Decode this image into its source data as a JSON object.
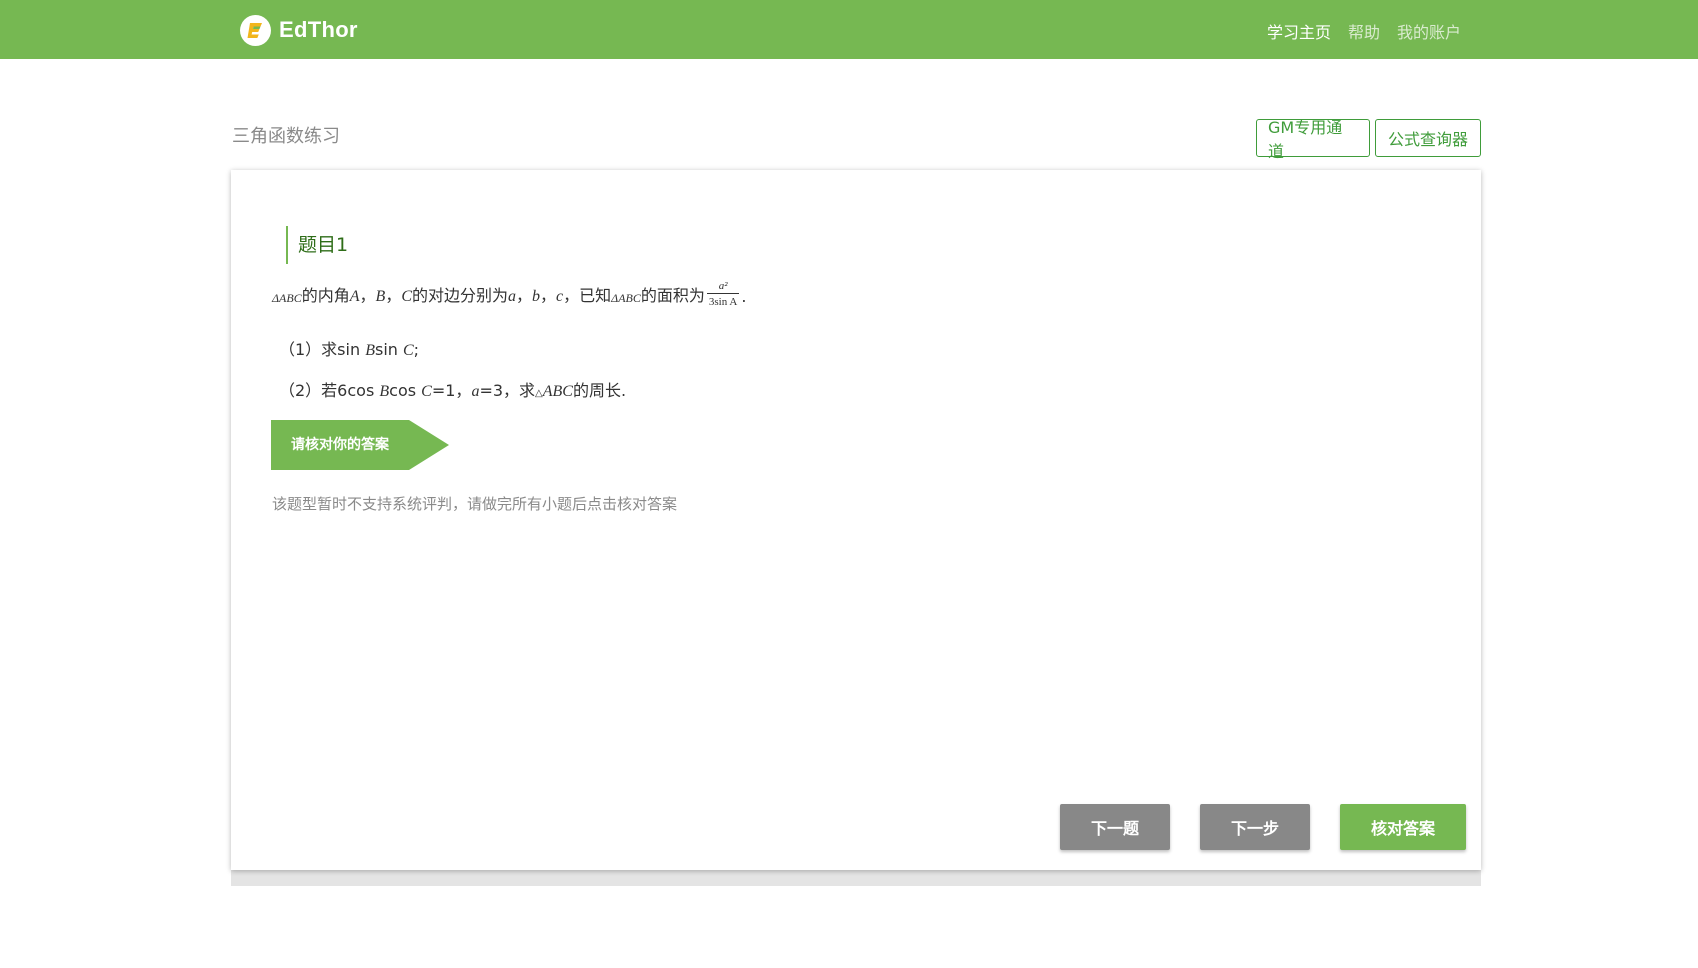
{
  "header": {
    "brand": "EdThor",
    "nav": [
      {
        "label": "学习主页",
        "active": true
      },
      {
        "label": "帮助",
        "active": false
      },
      {
        "label": "我的账户",
        "active": false
      }
    ]
  },
  "page": {
    "title": "三角函数练习",
    "gm_button": "GM专用通道",
    "formula_button": "公式查询器"
  },
  "question": {
    "heading": "题目1",
    "line1": {
      "tri1": "ΔABC",
      "t1": "的内角",
      "A": "A",
      "sep1": "，",
      "B": "B",
      "sep2": "，",
      "C": "C",
      "t2": "的对边分别为",
      "a": "a",
      "sep3": "，",
      "b": "b",
      "sep4": "，",
      "c": "c",
      "t3": "，已知",
      "tri2": "ΔABC",
      "t4": "的面积为",
      "frac_num": "a²",
      "frac_den": "3sin A",
      "end": "."
    },
    "part1": {
      "prefix": "（1）求sin ",
      "B": "B",
      "mid": "sin ",
      "C": "C",
      "end": ";"
    },
    "part2": {
      "prefix": "（2）若6cos ",
      "B": "B",
      "mid": "cos ",
      "C": "C",
      "eq1": "=1，",
      "a": "a",
      "eq2": "=3，求",
      "tri": "△",
      "ABC": "ABC",
      "end": "的周长."
    }
  },
  "answer": {
    "banner": "请核对你的答案",
    "hint": "该题型暂时不支持系统评判，请做完所有小题后点击核对答案"
  },
  "actions": {
    "next_question": "下一题",
    "next_step": "下一步",
    "check_answer": "核对答案"
  },
  "colors": {
    "brand_green": "#76b852",
    "dark_green": "#3f9c3a",
    "gray_button": "#888888"
  }
}
